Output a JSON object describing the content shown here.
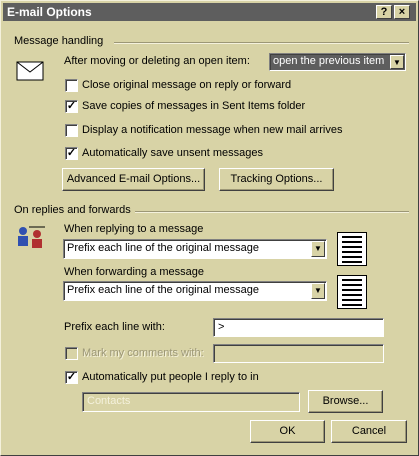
{
  "window": {
    "title": "E-mail Options",
    "help_btn": "?",
    "close_btn": "×"
  },
  "handling": {
    "header": "Message handling",
    "after_moving_label": "After moving or deleting an open item:",
    "after_moving_value": "open the previous item",
    "opt_close_original": "Close original message on reply or forward",
    "opt_save_copies": "Save copies of messages in Sent Items folder",
    "opt_display_notification": "Display a notification message when new mail arrives",
    "opt_autosave": "Automatically save unsent messages",
    "checked_mark": "✓",
    "advanced_btn": "Advanced E-mail Options...",
    "tracking_btn": "Tracking Options..."
  },
  "replies": {
    "header": "On replies and forwards",
    "replying_label": "When replying to a message",
    "replying_value": "Prefix each line of the original message",
    "forwarding_label": "When forwarding a message",
    "forwarding_value": "Prefix each line of the original message",
    "prefix_label": "Prefix each line with:",
    "prefix_value": ">",
    "mark_comments_label": "Mark my comments with:",
    "mark_comments_value": "",
    "auto_put_label": "Automatically put people I reply to in",
    "contacts_value": "Contacts",
    "browse_btn": "Browse..."
  },
  "footer": {
    "ok_btn": "OK",
    "cancel_btn": "Cancel"
  },
  "icons": {
    "envelope": "envelope-icon",
    "people": "people-icon",
    "reply_preview": "lines-icon",
    "dropdown": "▼"
  },
  "colors": {
    "dialog_bg": "#d8d3a6",
    "titlebar": "#5e5e5e",
    "selection": "#5e5e5e"
  }
}
